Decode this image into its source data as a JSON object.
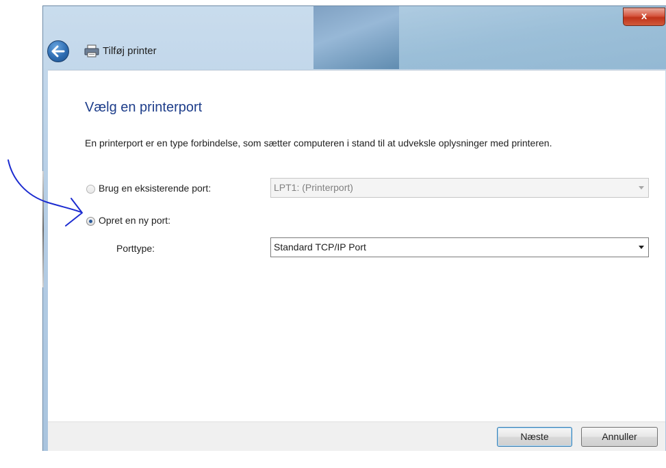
{
  "window": {
    "title": "Tilføj printer",
    "close_label": "x"
  },
  "page": {
    "heading": "Vælg en printerport",
    "description": "En printerport er en type forbindelse, som sætter computeren i stand til at udveksle oplysninger med printeren."
  },
  "options": {
    "existing_port": {
      "label": "Brug en eksisterende port:",
      "selected": false,
      "value": "LPT1: (Printerport)"
    },
    "new_port": {
      "label": "Opret en ny port:",
      "selected": true,
      "port_type_label": "Porttype:",
      "port_type_value": "Standard TCP/IP Port"
    }
  },
  "footer": {
    "next_label": "Næste",
    "cancel_label": "Annuller"
  },
  "icons": {
    "back": "back-arrow-icon",
    "printer": "printer-icon",
    "annotation": "hand-drawn-arrow"
  },
  "colors": {
    "heading": "#1d3d8a",
    "annotation": "#1b2bd0"
  }
}
